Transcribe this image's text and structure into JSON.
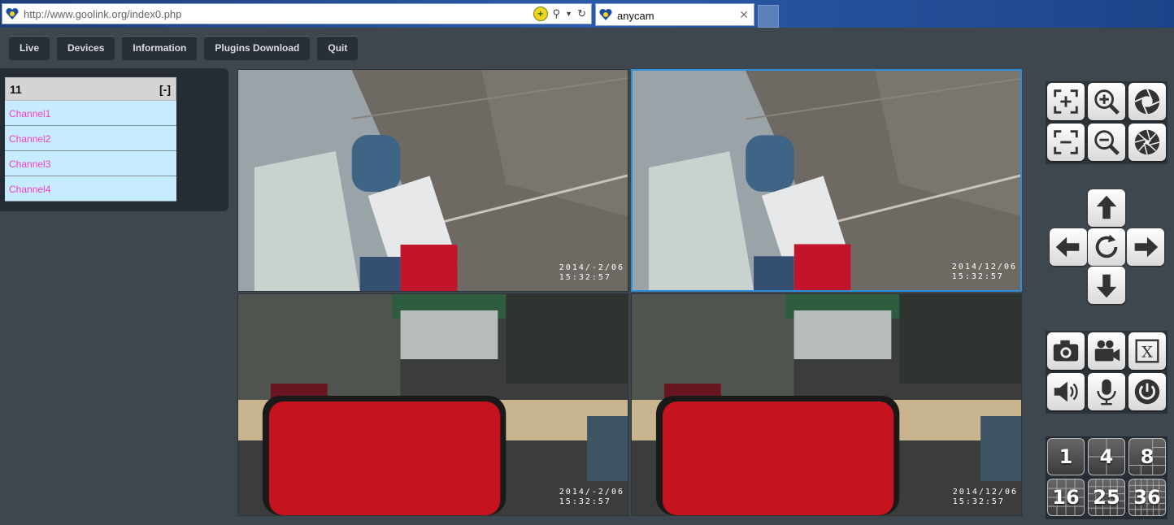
{
  "browser": {
    "url": "http://www.goolink.org/index0.php",
    "tab_title": "anycam"
  },
  "nav": {
    "buttons": [
      "Live",
      "Devices",
      "Information",
      "Plugins Download",
      "Quit"
    ]
  },
  "device_tree": {
    "device_name": "11",
    "toggle": "[-]",
    "channels": [
      "Channel1",
      "Channel2",
      "Channel3",
      "Channel4"
    ]
  },
  "videos": {
    "timestamps": [
      "2014/-2/06\n15:32:57",
      "2014/12/06\n15:32:57",
      "2014/-2/06\n15:32:57",
      "2014/12/06\n15:32:57"
    ],
    "selected_index": 1
  },
  "ptz": {
    "zoom_icons": [
      "focus-plus-icon",
      "zoom-in-icon",
      "iris-open-icon",
      "focus-minus-icon",
      "zoom-out-icon",
      "iris-close-icon"
    ],
    "direction_icons": [
      "arrow-up-icon",
      "arrow-left-icon",
      "refresh-icon",
      "arrow-right-icon",
      "arrow-down-icon"
    ],
    "action_icons": [
      "camera-icon",
      "video-camera-icon",
      "close-x-icon",
      "speaker-icon",
      "microphone-icon",
      "power-icon"
    ],
    "close_label": "X"
  },
  "layout_buttons": [
    "1",
    "4",
    "8",
    "16",
    "25",
    "36"
  ],
  "colors": {
    "background": "#3e464e",
    "channel_bg": "#c8ecff",
    "channel_text": "#f03cc4",
    "selected_border": "#2e8fd8"
  }
}
